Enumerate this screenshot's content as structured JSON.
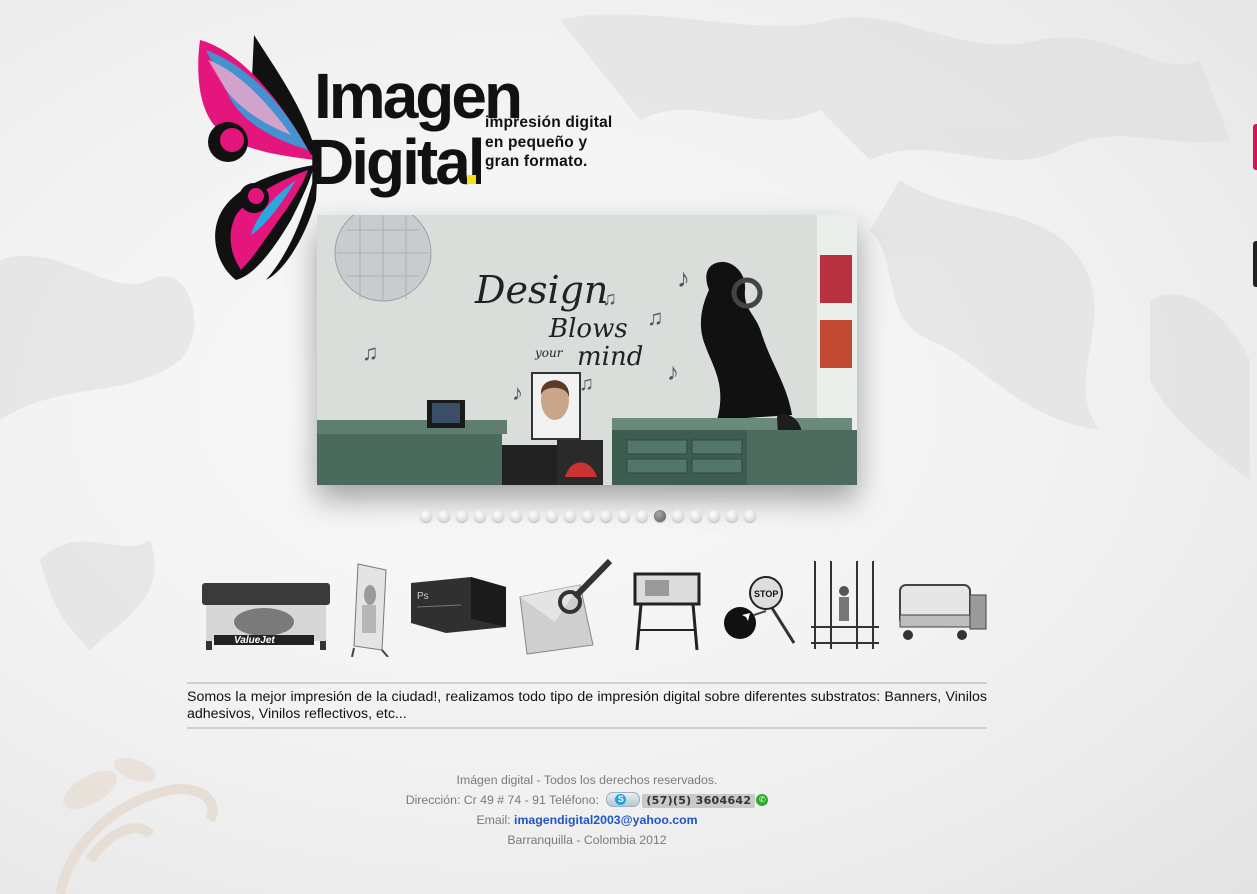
{
  "logo": {
    "word_top": "Imagen",
    "word_bottom": "Digital",
    "tagline_lines": [
      "impresión digital",
      "en pequeño y",
      "gran formato."
    ]
  },
  "slider": {
    "dot_count": 19,
    "active_dot_index": 13,
    "slide_text": [
      "Design",
      "Blows",
      "your",
      "mind"
    ]
  },
  "thumbnails": [
    {
      "icon": "large-format-printer-icon",
      "label": "ValueJet"
    },
    {
      "icon": "roll-up-banner-icon"
    },
    {
      "icon": "photoshop-box-icon",
      "label": "Ps"
    },
    {
      "icon": "vinyl-tool-icon"
    },
    {
      "icon": "plotter-icon"
    },
    {
      "icon": "stop-sign-icon",
      "label": "STOP"
    },
    {
      "icon": "scaffold-installer-icon"
    },
    {
      "icon": "laminator-machine-icon"
    }
  ],
  "description": "Somos la mejor impresión de la ciudad!, realizamos todo tipo de impresión digital sobre diferentes substratos: Banners, Vinilos adhesivos, Vinilos reflectivos, etc...",
  "footer": {
    "rights": "Imágen digital - Todos los derechos reservados.",
    "address_label": "Dirección: Cr 49 # 74 - 91 Teléfono:",
    "phone": "(57)(5) 3604642",
    "email_label": "Email:",
    "email": "imagendigital2003@yahoo.com",
    "city": "Barranquilla - Colombia 2012"
  },
  "colors": {
    "link": "#1f55c8",
    "logo_magenta": "#e4157d",
    "logo_cyan": "#29a8df",
    "logo_yellow": "#f5e11b",
    "side_tab_pink": "#d4145a"
  }
}
